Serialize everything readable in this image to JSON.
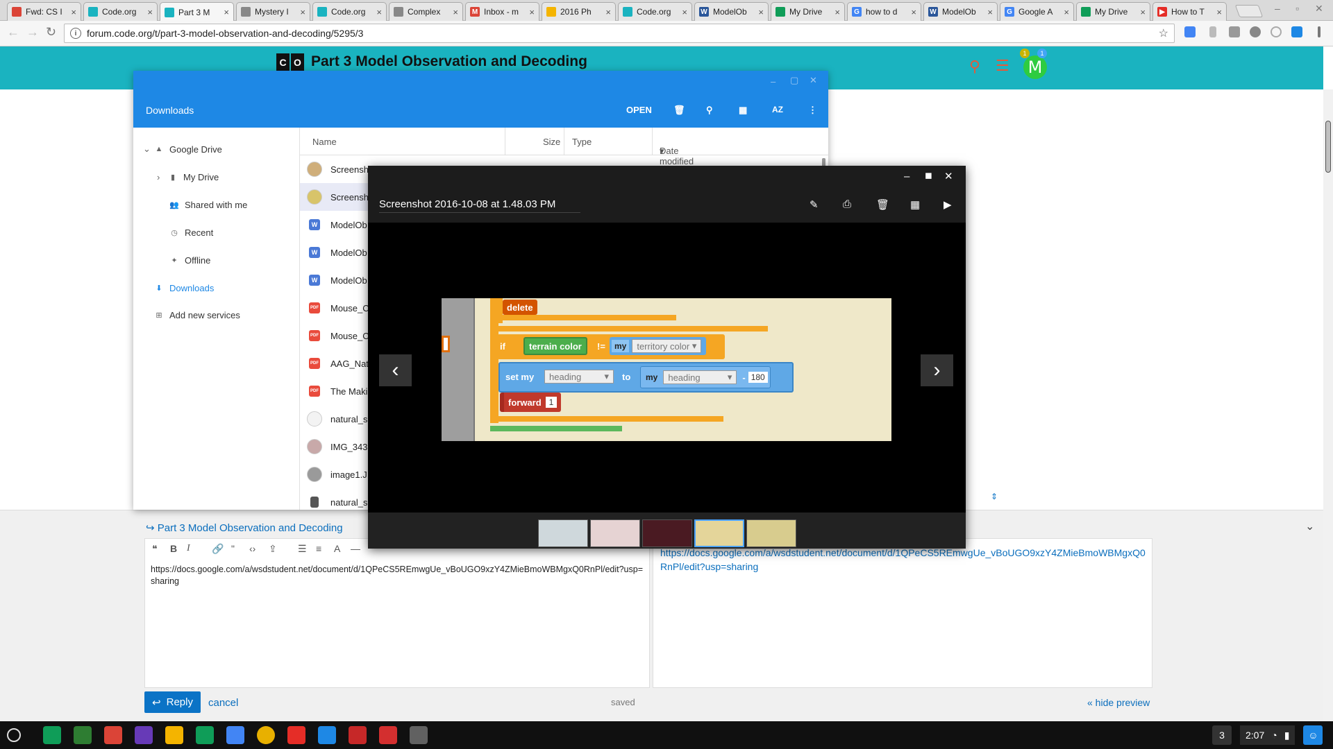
{
  "browser": {
    "tabs": [
      {
        "label": "Fwd: CS I",
        "color": "#db4437",
        "glyph": ""
      },
      {
        "label": "Code.org",
        "color": "#1ab3c0",
        "glyph": ""
      },
      {
        "label": "Part 3 M",
        "color": "#1ab3c0",
        "glyph": "",
        "active": true
      },
      {
        "label": "Mystery I",
        "color": "#888888",
        "glyph": ""
      },
      {
        "label": "Code.org",
        "color": "#1ab3c0",
        "glyph": ""
      },
      {
        "label": "Complex",
        "color": "#888888",
        "glyph": ""
      },
      {
        "label": "Inbox - m",
        "color": "#db4437",
        "glyph": "M"
      },
      {
        "label": "2016 Ph",
        "color": "#f4b400",
        "glyph": ""
      },
      {
        "label": "Code.org",
        "color": "#1ab3c0",
        "glyph": ""
      },
      {
        "label": "ModelOb",
        "color": "#2b579a",
        "glyph": "W"
      },
      {
        "label": "My Drive",
        "color": "#0f9d58",
        "glyph": ""
      },
      {
        "label": "how to d",
        "color": "#4285f4",
        "glyph": "G"
      },
      {
        "label": "ModelOb",
        "color": "#2b579a",
        "glyph": "W"
      },
      {
        "label": "Google A",
        "color": "#4285f4",
        "glyph": "G"
      },
      {
        "label": "My Drive",
        "color": "#0f9d58",
        "glyph": ""
      },
      {
        "label": "How to T",
        "color": "#e52d27",
        "glyph": "▶"
      }
    ],
    "url": "forum.code.org/t/part-3-model-observation-and-decoding/5295/3",
    "info_icon": "info-icon",
    "star_icon": "star-icon"
  },
  "site": {
    "logo_letters": [
      "C",
      "O"
    ],
    "title": "Part 3 Model Observation and Decoding",
    "avatar_letter": "M",
    "notifications": [
      "1",
      "1"
    ]
  },
  "files": {
    "title": "Downloads",
    "open_label": "OPEN",
    "sort_label": "AZ",
    "sidebar": [
      {
        "label": "Google Drive",
        "icon": "drive-icon"
      },
      {
        "label": "My Drive",
        "icon": "folder-icon"
      },
      {
        "label": "Shared with me",
        "icon": "people-icon"
      },
      {
        "label": "Recent",
        "icon": "clock-icon"
      },
      {
        "label": "Offline",
        "icon": "pin-icon"
      },
      {
        "label": "Downloads",
        "icon": "download-icon"
      },
      {
        "label": "Add new services",
        "icon": "plus-icon"
      }
    ],
    "columns": {
      "name": "Name",
      "size": "Size",
      "type": "Type",
      "date": "Date modified"
    },
    "rows": [
      {
        "name": "Screensh",
        "kind": "img",
        "color": "#cfae7a"
      },
      {
        "name": "Screensh",
        "kind": "img",
        "color": "#d8c46a",
        "selected": true
      },
      {
        "name": "ModelOb",
        "kind": "W",
        "color": "#4a79d6"
      },
      {
        "name": "ModelOb",
        "kind": "W",
        "color": "#4a79d6"
      },
      {
        "name": "ModelOb",
        "kind": "W",
        "color": "#4a79d6"
      },
      {
        "name": "Mouse_C",
        "kind": "PDF",
        "color": "#e94b3c"
      },
      {
        "name": "Mouse_C",
        "kind": "PDF",
        "color": "#e94b3c"
      },
      {
        "name": "AAG_Nat",
        "kind": "PDF",
        "color": "#e94b3c"
      },
      {
        "name": "The Maki",
        "kind": "PDF",
        "color": "#e94b3c"
      },
      {
        "name": "natural_s",
        "kind": "img",
        "color": "#f3f3f3"
      },
      {
        "name": "IMG_343",
        "kind": "img",
        "color": "#c8a9a9"
      },
      {
        "name": "image1.J",
        "kind": "img",
        "color": "#9a9a9a"
      },
      {
        "name": "natural_s",
        "kind": "file",
        "color": "#555555"
      }
    ]
  },
  "gallery": {
    "title": "Screenshot 2016-10-08 at 1.48.03 PM",
    "blocks": {
      "delete": "delete",
      "if": "if",
      "terrain_color": "terrain color",
      "neq": "!=",
      "my": "my",
      "territory_color": "territory color",
      "set_my": "set my",
      "heading": "heading",
      "to": "to",
      "my2": "my",
      "heading2": "heading",
      "minus": "-",
      "value_180": "180",
      "forward": "forward",
      "value_1": "1"
    }
  },
  "composer": {
    "reply_title": "Part 3 Model Observation and Decoding",
    "editor_text": "https://docs.google.com/a/wsdstudent.net/document/d/1QPeCS5REmwgUe_vBoUGO9xzY4ZMieBmoWBMgxQ0RnPl/edit?usp=sharing",
    "preview_text": "https://docs.google.com/a/wsdstudent.net/document/d/1QPeCS5REmwgUe_vBoUGO9xzY4ZMieBmoWBMgxQ0RnPl/edit?usp=sharing",
    "reply_label": "Reply",
    "cancel_label": "cancel",
    "saved_label": "saved",
    "hide_preview_label": "« hide preview"
  },
  "shelf": {
    "apps": [
      {
        "name": "drive",
        "color": "#0f9d58"
      },
      {
        "name": "classroom",
        "color": "#2e7d32"
      },
      {
        "name": "gmail",
        "color": "#db4437"
      },
      {
        "name": "forms",
        "color": "#673ab7"
      },
      {
        "name": "slides",
        "color": "#f4b400"
      },
      {
        "name": "sheets",
        "color": "#0f9d58"
      },
      {
        "name": "docs",
        "color": "#4285f4"
      },
      {
        "name": "chrome",
        "color": "#e8b000"
      },
      {
        "name": "youtube",
        "color": "#e52d27"
      },
      {
        "name": "files",
        "color": "#1e88e5"
      },
      {
        "name": "video",
        "color": "#c62828"
      },
      {
        "name": "camera",
        "color": "#d32f2f"
      },
      {
        "name": "settings",
        "color": "#616161"
      }
    ],
    "badge": "3",
    "time": "2:07"
  },
  "colors": {
    "accent": "#1ab3c0",
    "files_blue": "#1e88e5",
    "link": "#0a6ebd"
  }
}
